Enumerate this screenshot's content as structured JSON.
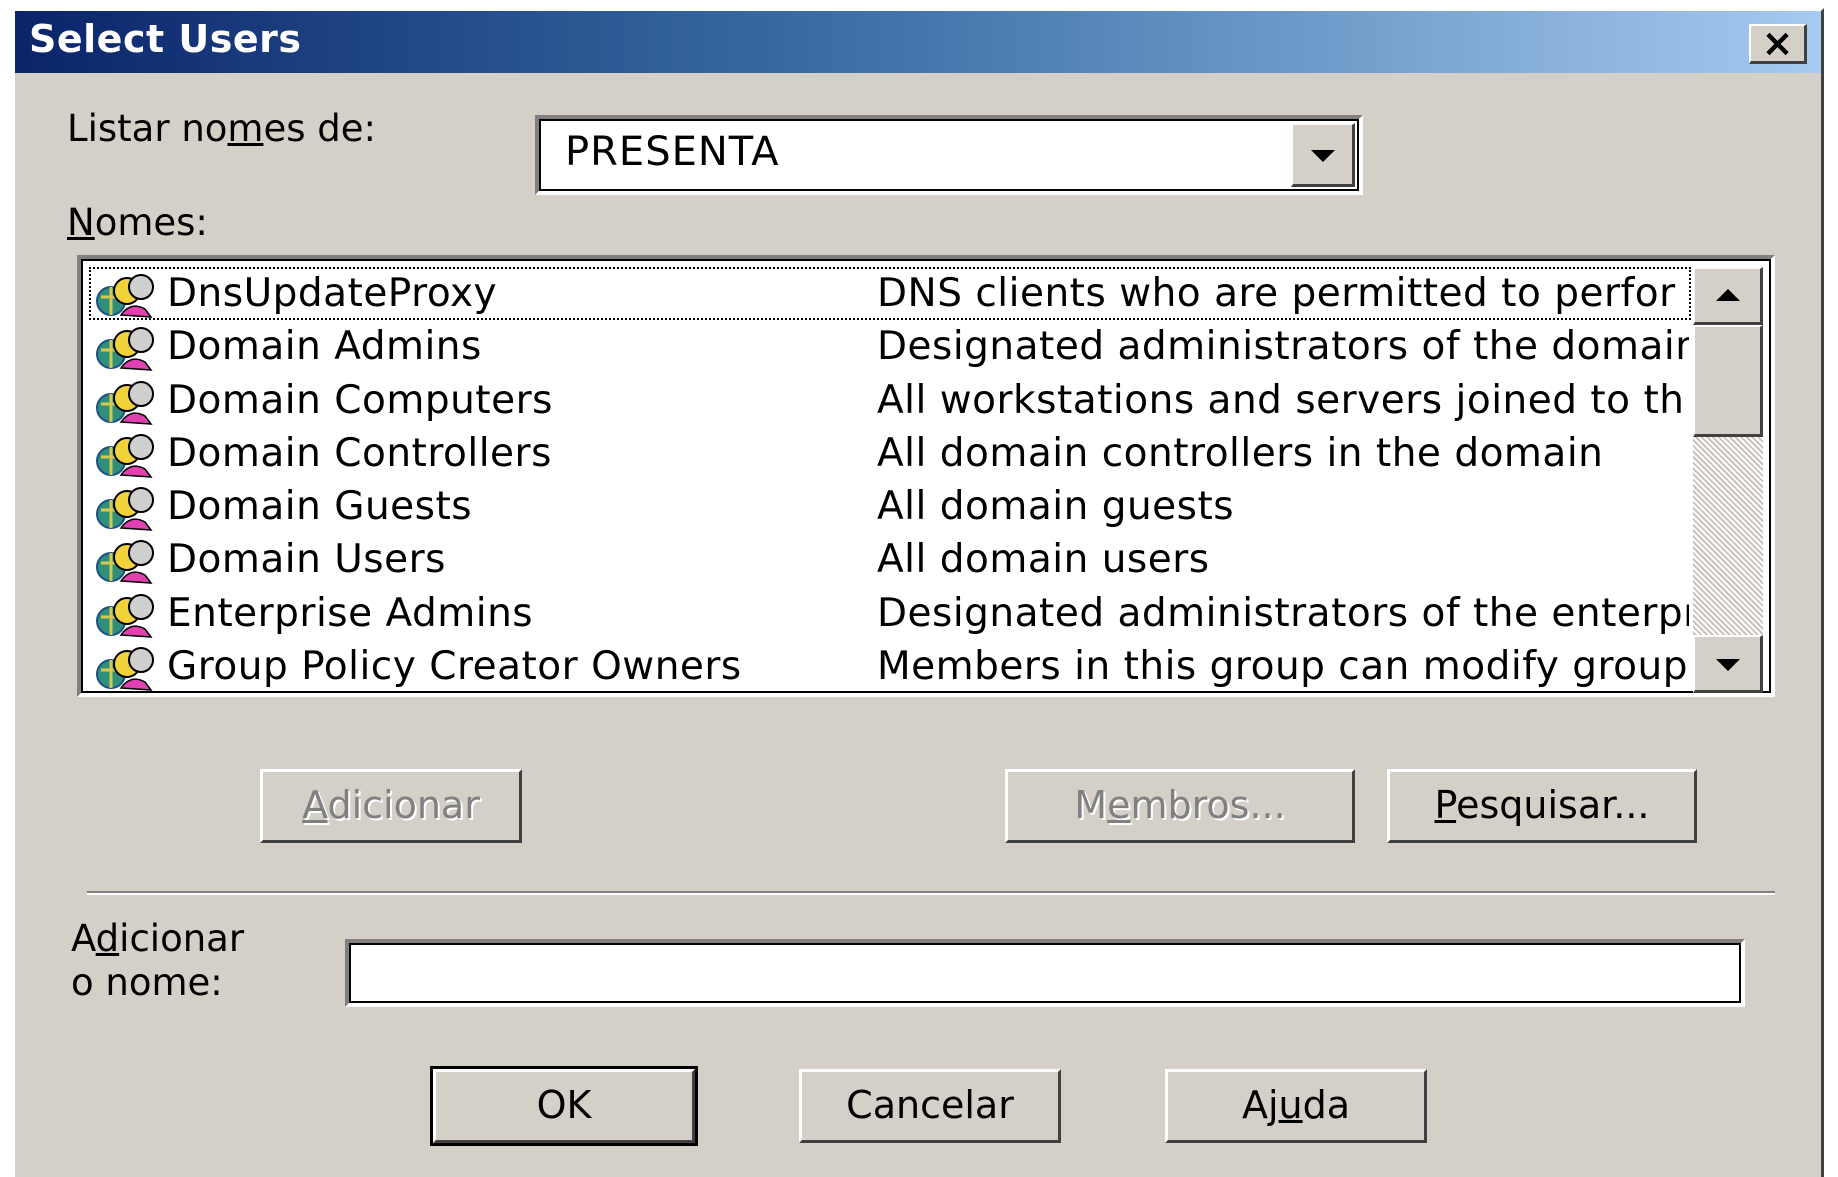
{
  "window": {
    "title": "Select Users",
    "close_glyph": "×"
  },
  "list_from": {
    "label_pre": "Listar no",
    "label_accel": "m",
    "label_post": "es de:",
    "value": "PRESENTA"
  },
  "names": {
    "label_accel": "N",
    "label_post": "omes:",
    "rows": [
      {
        "name": "DnsUpdateProxy",
        "description": "DNS clients who are permitted to perfor",
        "focused": true
      },
      {
        "name": "Domain Admins",
        "description": "Designated administrators of the domain",
        "focused": false
      },
      {
        "name": "Domain Computers",
        "description": "All workstations and servers joined to th",
        "focused": false
      },
      {
        "name": "Domain Controllers",
        "description": "All domain controllers in the domain",
        "focused": false
      },
      {
        "name": "Domain Guests",
        "description": "All domain guests",
        "focused": false
      },
      {
        "name": "Domain Users",
        "description": "All domain users",
        "focused": false
      },
      {
        "name": "Enterprise Admins",
        "description": "Designated administrators of the enterpr",
        "focused": false
      },
      {
        "name": "Group Policy Creator Owners",
        "description": "Members in this group can modify group",
        "focused": false
      }
    ],
    "row_icon": "user-group-icon"
  },
  "actions": {
    "add": {
      "pre": "",
      "accel": "A",
      "post": "dicionar"
    },
    "members": {
      "pre": "M",
      "accel": "e",
      "post": "mbros..."
    },
    "search": {
      "pre": "",
      "accel": "P",
      "post": "esquisar..."
    }
  },
  "add_name": {
    "line1_pre": "A",
    "line1_accel": "d",
    "line1_post": "icionar",
    "line2": "o nome:",
    "value": ""
  },
  "footer": {
    "ok": "OK",
    "cancel": "Cancelar",
    "help": {
      "pre": "Aj",
      "accel": "u",
      "post": "da"
    }
  },
  "colors": {
    "title_start": "#0a246a",
    "title_end": "#a6caf0",
    "face": "#d4d0c8"
  }
}
